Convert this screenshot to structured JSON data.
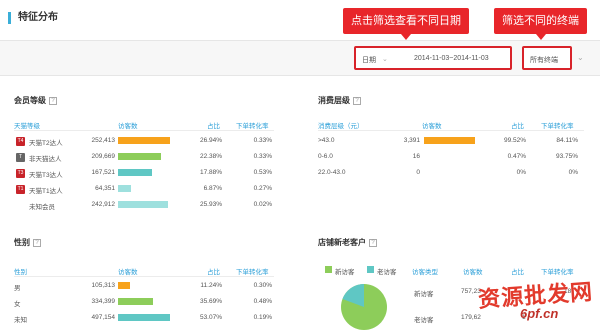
{
  "callouts": {
    "date": "点击筛选查看不同日期",
    "terminal": "筛选不同的终端"
  },
  "header": {
    "title": "特征分布",
    "date_label": "日期",
    "date_value": "2014-11-03~2014-11-03",
    "terminal_value": "所有终端"
  },
  "member_level": {
    "title": "会员等级",
    "columns": [
      "天猫等级",
      "访客数",
      "占比",
      "下单转化率"
    ],
    "rows": [
      {
        "badge": "T4",
        "name": "天猫T2达人",
        "visitors": "252,413",
        "share": "26.94%",
        "conv": "0.33%"
      },
      {
        "badge": "T",
        "name": "非天猫达人",
        "visitors": "209,669",
        "share": "22.38%",
        "conv": "0.33%"
      },
      {
        "badge": "T3",
        "name": "天猫T3达人",
        "visitors": "167,521",
        "share": "17.88%",
        "conv": "0.53%"
      },
      {
        "badge": "T1",
        "name": "天猫T1达人",
        "visitors": "64,351",
        "share": "6.87%",
        "conv": "0.27%"
      },
      {
        "badge": "",
        "name": "未知会员",
        "visitors": "242,912",
        "share": "25.93%",
        "conv": "0.02%"
      }
    ]
  },
  "spend_level": {
    "title": "消费层级",
    "columns": [
      "消费层级（元）",
      "访客数",
      "占比",
      "下单转化率"
    ],
    "rows": [
      {
        "name": ">43.0",
        "visitors": "3,391",
        "share": "99.52%",
        "conv": "84.11%"
      },
      {
        "name": "0-6.0",
        "visitors": "16",
        "share": "0.47%",
        "conv": "93.75%"
      },
      {
        "name": "22.0-43.0",
        "visitors": "0",
        "share": "0%",
        "conv": "0%"
      }
    ]
  },
  "gender": {
    "title": "性别",
    "columns": [
      "性别",
      "访客数",
      "占比",
      "下单转化率"
    ],
    "rows": [
      {
        "name": "男",
        "visitors": "105,313",
        "share": "11.24%",
        "conv": "0.30%"
      },
      {
        "name": "女",
        "visitors": "334,399",
        "share": "35.69%",
        "conv": "0.48%"
      },
      {
        "name": "未知",
        "visitors": "497,154",
        "share": "53.07%",
        "conv": "0.19%"
      }
    ]
  },
  "new_old": {
    "title": "店铺新老客户",
    "legend_new": "新访客",
    "legend_old": "老访客",
    "columns": [
      "访客类型",
      "访客数",
      "占比",
      "下单转化率"
    ],
    "rows": [
      {
        "name": "新访客",
        "visitors": "757,23",
        "tail": "18"
      },
      {
        "name": "老访客",
        "visitors": "179,62",
        "tail": "1"
      }
    ]
  },
  "watermark": {
    "cn": "资源批发网",
    "url": "6pf.cn"
  },
  "colors": {
    "accent_blue": "#2b9fd8",
    "orange": "#f7a21b",
    "green": "#8dcd5a",
    "teal": "#5fc7c4",
    "light_teal": "#9ee0de",
    "callout_red": "#e8262a"
  }
}
